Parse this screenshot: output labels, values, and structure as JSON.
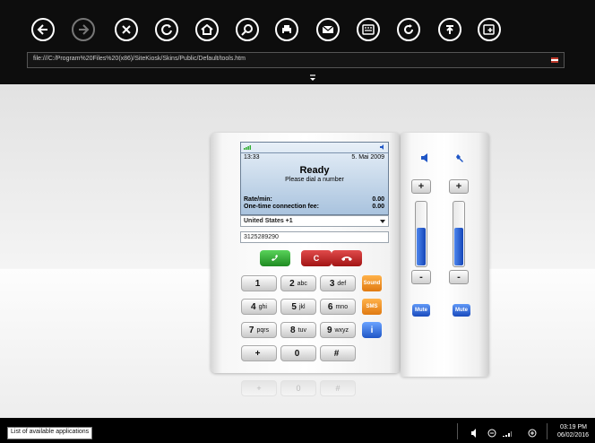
{
  "toolbar": {
    "buttons": [
      {
        "name": "back-button",
        "icon": "arrow-left-icon"
      },
      {
        "name": "forward-button",
        "icon": "arrow-right-icon"
      },
      {
        "name": "stop-button",
        "icon": "close-icon"
      },
      {
        "name": "refresh-button",
        "icon": "refresh-icon"
      },
      {
        "name": "home-button",
        "icon": "home-icon"
      },
      {
        "name": "search-button",
        "icon": "search-icon"
      },
      {
        "name": "print-button",
        "icon": "print-icon"
      },
      {
        "name": "email-button",
        "icon": "email-icon"
      },
      {
        "name": "keyboard-button",
        "icon": "keyboard-icon"
      },
      {
        "name": "reload-button",
        "icon": "reload-icon"
      },
      {
        "name": "upload-button",
        "icon": "upload-icon"
      },
      {
        "name": "new-tab-button",
        "icon": "add-window-icon"
      }
    ],
    "address": "file:///C:/Program%20Files%20(x86)/SiteKiosk/Skins/Public/Default/tools.htm"
  },
  "phone": {
    "screen": {
      "time": "13:33",
      "date": "5. Mai 2009",
      "status": "Ready",
      "message": "Please dial a number",
      "rate_label": "Rate/min:",
      "rate_value": "0.00",
      "fee_label": "One-time connection fee:",
      "fee_value": "0.00"
    },
    "country": "United States +1",
    "number": "3125289290",
    "clear_label": "C",
    "keys": [
      {
        "digit": "1",
        "letters": ""
      },
      {
        "digit": "2",
        "letters": "abc"
      },
      {
        "digit": "3",
        "letters": "def"
      },
      {
        "digit": "4",
        "letters": "ghi"
      },
      {
        "digit": "5",
        "letters": "jkl"
      },
      {
        "digit": "6",
        "letters": "mno"
      },
      {
        "digit": "7",
        "letters": "pqrs"
      },
      {
        "digit": "8",
        "letters": "tuv"
      },
      {
        "digit": "9",
        "letters": "wxyz"
      },
      {
        "digit": "+",
        "letters": ""
      },
      {
        "digit": "0",
        "letters": ""
      },
      {
        "digit": "#",
        "letters": ""
      }
    ],
    "side_buttons": {
      "sound": "Sound",
      "sms": "SMS",
      "info": "i"
    },
    "reflection_keys": [
      "+",
      "0",
      "#"
    ]
  },
  "volume": {
    "speaker": {
      "plus": "+",
      "minus": "-",
      "mute": "Mute",
      "level": 0.58
    },
    "microphone": {
      "plus": "+",
      "minus": "-",
      "mute": "Mute",
      "level": 0.58
    }
  },
  "taskbar": {
    "tooltip": "List of available applications",
    "time": "03:19 PM",
    "date": "06/02/2016"
  },
  "colors": {
    "accent_blue": "#1f56c6",
    "call_green": "#1f8b22",
    "hangup_red": "#a21414",
    "soft_orange": "#e07a12"
  }
}
